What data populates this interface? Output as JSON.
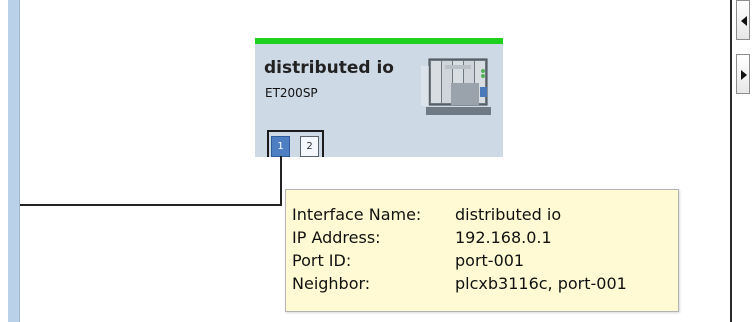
{
  "device": {
    "name": "distributed io",
    "type": "ET200SP",
    "ports": [
      "1",
      "2"
    ],
    "status_color": "#1fd11f",
    "image_icon": "et200sp-module-icon"
  },
  "tooltip": {
    "rows": [
      {
        "label": "Interface Name:",
        "value": "distributed io"
      },
      {
        "label": "IP Address:",
        "value": "192.168.0.1"
      },
      {
        "label": "Port ID:",
        "value": "port-001"
      },
      {
        "label": "Neighbor:",
        "value": "plcxb3116c, port-001"
      }
    ]
  },
  "controls": {
    "scroll_left_icon": "triangle-left-icon",
    "scroll_right_icon": "triangle-right-icon"
  }
}
